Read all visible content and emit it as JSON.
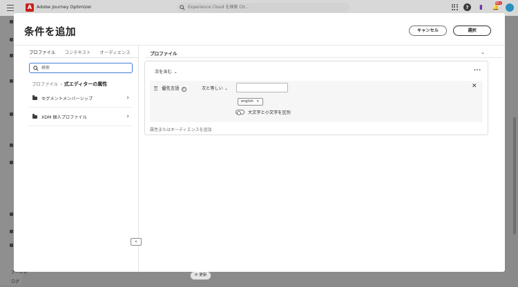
{
  "app": {
    "title": "Adobe Journey Optimizer",
    "logo_letter": "A"
  },
  "global_search": {
    "placeholder": "Experience Cloud を検索 Ctr..."
  },
  "notifications": {
    "count": "99+"
  },
  "modal": {
    "title": "条件を追加",
    "cancel_label": "キャンセル",
    "select_label": "選択"
  },
  "left_panel": {
    "tabs": [
      {
        "label": "プロファイル",
        "active": true
      },
      {
        "label": "コンテキスト",
        "active": false
      },
      {
        "label": "オーディエンス",
        "active": false
      }
    ],
    "search_placeholder": "検索",
    "breadcrumb": {
      "root": "プロファイル",
      "separator": "›",
      "current": "式エディターの属性"
    },
    "items": [
      {
        "label": "セグメントメンバーシップ"
      },
      {
        "label": "XDM 個人プロファイル"
      }
    ],
    "collapse_glyph": "‹"
  },
  "right_panel": {
    "title": "プロファイル",
    "group_operator": "次を含む",
    "condition": {
      "attribute": "優先言語",
      "operator": "次と等しい",
      "value": "",
      "tags": [
        "english"
      ],
      "case_toggle_label": "大文字と小文字を区別",
      "case_sensitive": false
    },
    "add_link": "属性またはオーディエンスを追加"
  },
  "background": {
    "nav_items": [
      "アーキテ",
      "ログ"
    ],
    "refresh_label": "更新"
  }
}
